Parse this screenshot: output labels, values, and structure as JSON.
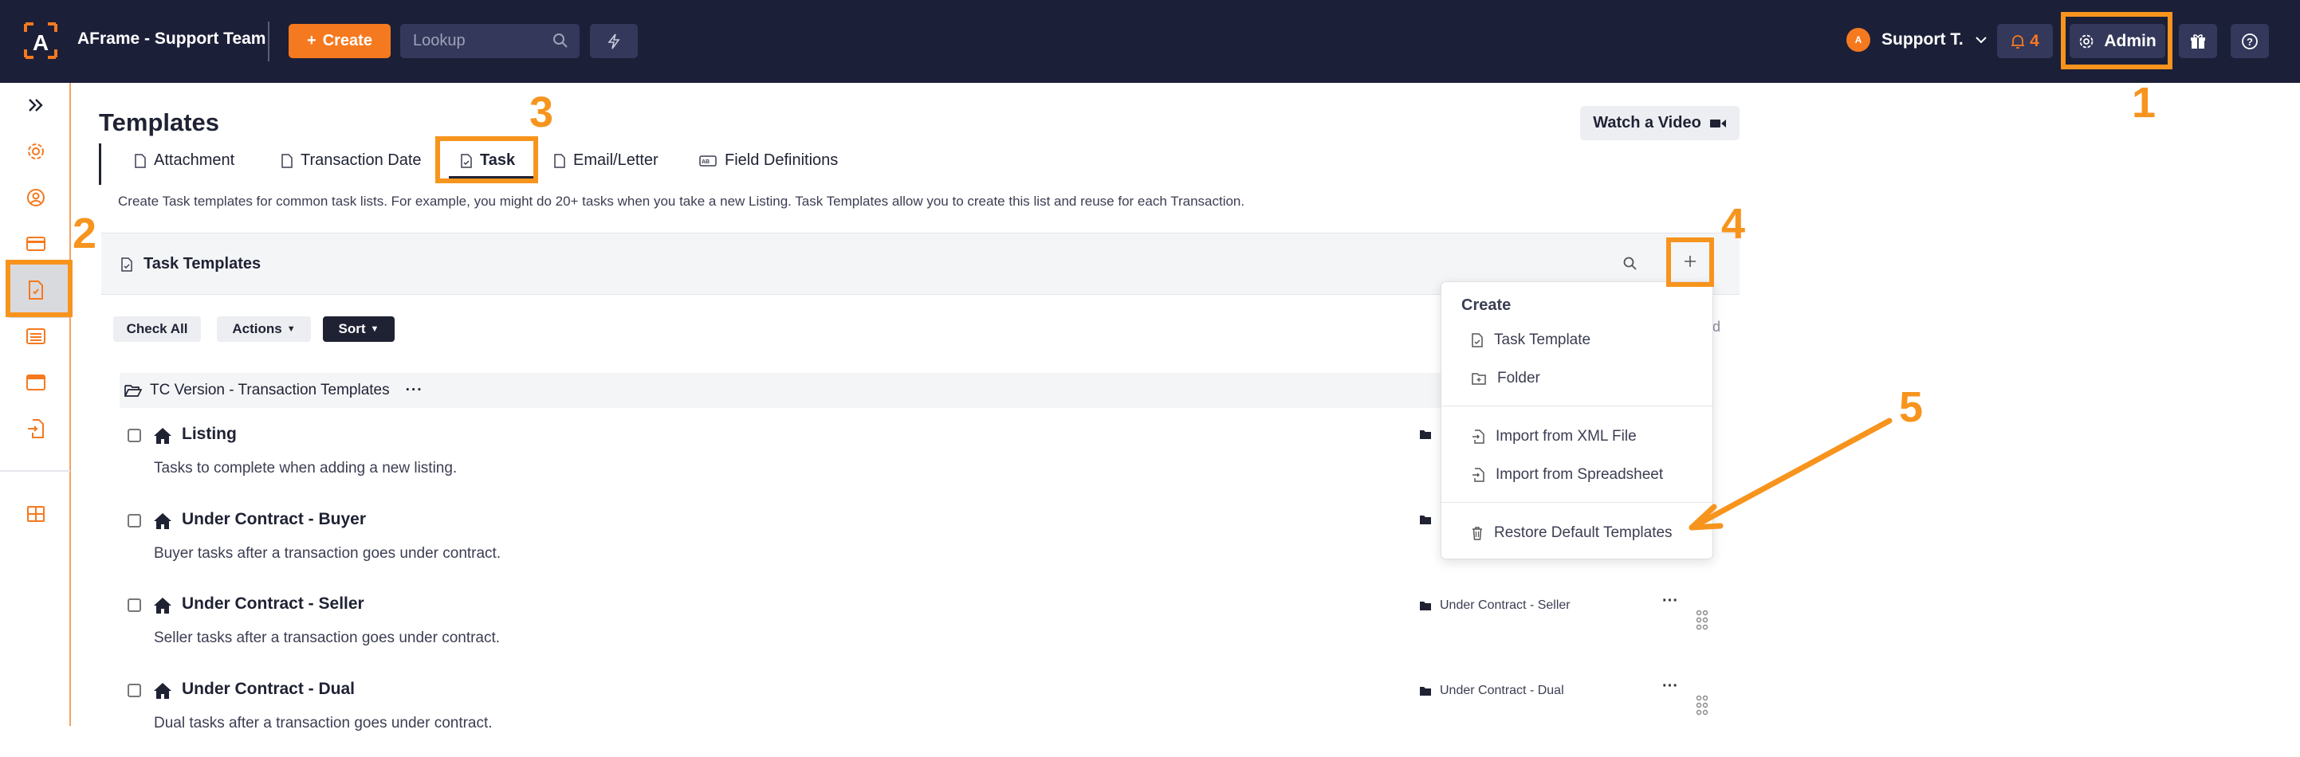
{
  "topbar": {
    "app_name": "AFrame - Support Team",
    "create_label": "Create",
    "lookup_placeholder": "Lookup",
    "user_label": "Support T.",
    "avatar_initial": "A",
    "notification_count": "4",
    "admin_label": "Admin"
  },
  "page": {
    "title": "Templates",
    "watch_video_label": "Watch a Video",
    "description": "Create Task templates for common task lists. For example, you might do 20+ tasks when you take a new Listing. Task Templates allow you to create this list and reuse for each Transaction."
  },
  "tabs": [
    {
      "label": "Attachment"
    },
    {
      "label": "Transaction Date"
    },
    {
      "label": "Task",
      "active": true
    },
    {
      "label": "Email/Letter"
    },
    {
      "label": "Field Definitions"
    }
  ],
  "panel": {
    "title": "Task Templates",
    "check_all": "Check All",
    "actions": "Actions",
    "sort": "Sort",
    "partial_text": "ed"
  },
  "folder": {
    "name": "TC Version - Transaction Templates",
    "more": "···"
  },
  "templates": [
    {
      "name": "Listing",
      "description": "Tasks to complete when adding a new listing.",
      "folder": ""
    },
    {
      "name": "Under Contract - Buyer",
      "description": "Buyer tasks after a transaction goes under contract.",
      "folder": ""
    },
    {
      "name": "Under Contract - Seller",
      "description": "Seller tasks after a transaction goes under contract.",
      "folder": "Under Contract - Seller"
    },
    {
      "name": "Under Contract - Dual",
      "description": "Dual tasks after a transaction goes under contract.",
      "folder": "Under Contract - Dual"
    }
  ],
  "dropdown": {
    "header": "Create",
    "items": [
      {
        "label": "Task Template",
        "icon": "file-icon"
      },
      {
        "label": "Folder",
        "icon": "folder-plus-icon"
      },
      {
        "label": "Import from XML File",
        "icon": "import-icon"
      },
      {
        "label": "Import from Spreadsheet",
        "icon": "import-icon"
      },
      {
        "label": "Restore Default Templates",
        "icon": "trash-icon"
      }
    ]
  },
  "annotations": {
    "n1": "1",
    "n2": "2",
    "n3": "3",
    "n4": "4",
    "n5": "5"
  },
  "colors": {
    "topbar": "#1c1f38",
    "accent": "#f5791f",
    "annotation": "#f7941d"
  }
}
